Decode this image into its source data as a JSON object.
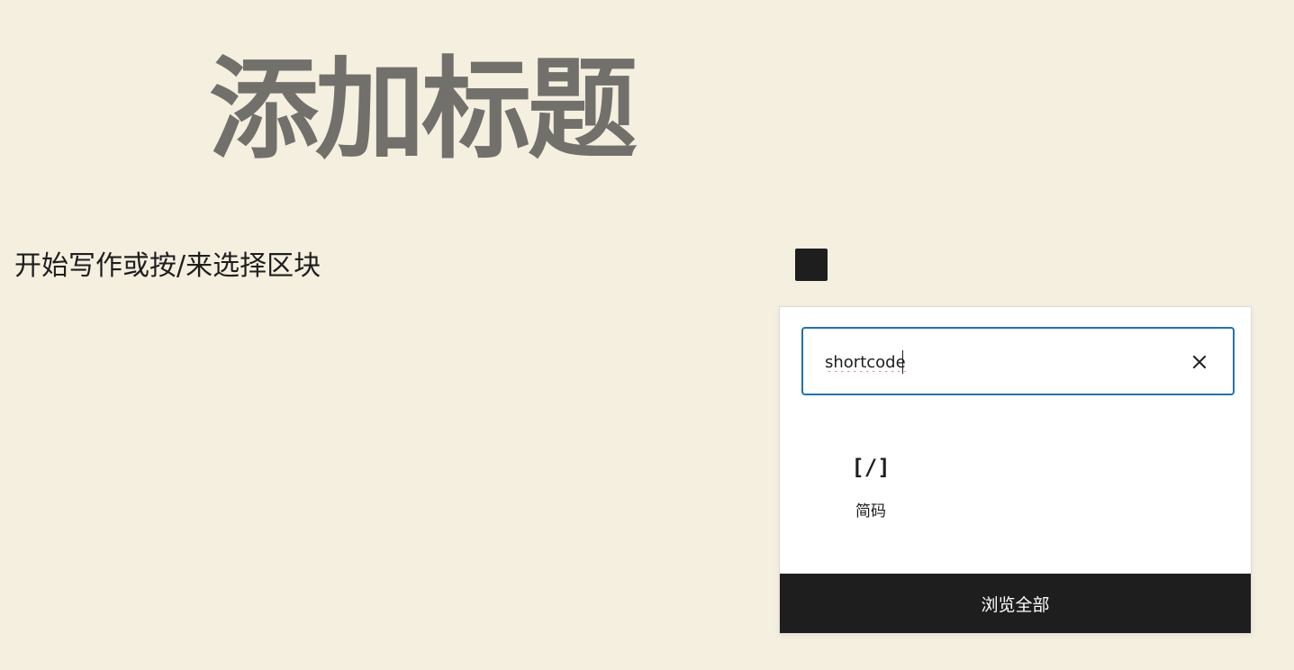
{
  "editor": {
    "title_placeholder": "添加标题",
    "paragraph_placeholder": "开始写作或按/来选择区块"
  },
  "inserter": {
    "search_value": "shortcode",
    "clear_icon": "close-icon",
    "results": [
      {
        "icon": "[/]",
        "icon_name": "shortcode-icon",
        "label": "简码"
      }
    ],
    "browse_all_label": "浏览全部"
  },
  "colors": {
    "background": "#f5efe0",
    "title": "#71706b",
    "accent": "#2271b1",
    "dark": "#1e1e1e"
  }
}
